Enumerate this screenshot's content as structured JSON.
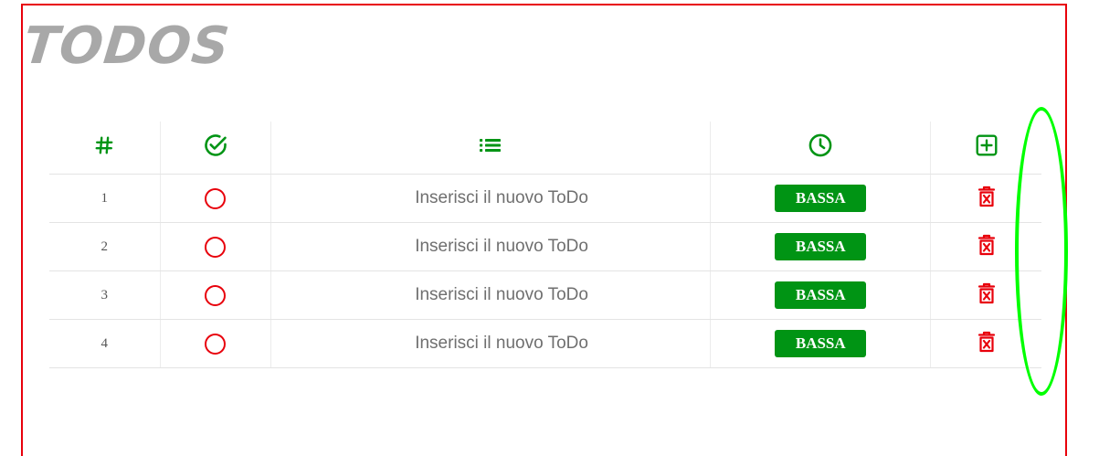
{
  "app": {
    "title": "TODOS"
  },
  "table": {
    "headers": [
      {
        "icon": "hash-icon"
      },
      {
        "icon": "check-circle-icon"
      },
      {
        "icon": "list-icon"
      },
      {
        "icon": "clock-icon"
      },
      {
        "icon": "plus-square-icon"
      }
    ],
    "rows": [
      {
        "number": "1",
        "text": "Inserisci il nuovo ToDo",
        "priority": "BASSA"
      },
      {
        "number": "2",
        "text": "Inserisci il nuovo ToDo",
        "priority": "BASSA"
      },
      {
        "number": "3",
        "text": "Inserisci il nuovo ToDo",
        "priority": "BASSA"
      },
      {
        "number": "4",
        "text": "Inserisci il nuovo ToDo",
        "priority": "BASSA"
      }
    ]
  },
  "colors": {
    "accent_green": "#009414",
    "danger_red": "#e8000b",
    "title_gray": "#a8a8a8",
    "annotation_green": "#00ff00"
  }
}
